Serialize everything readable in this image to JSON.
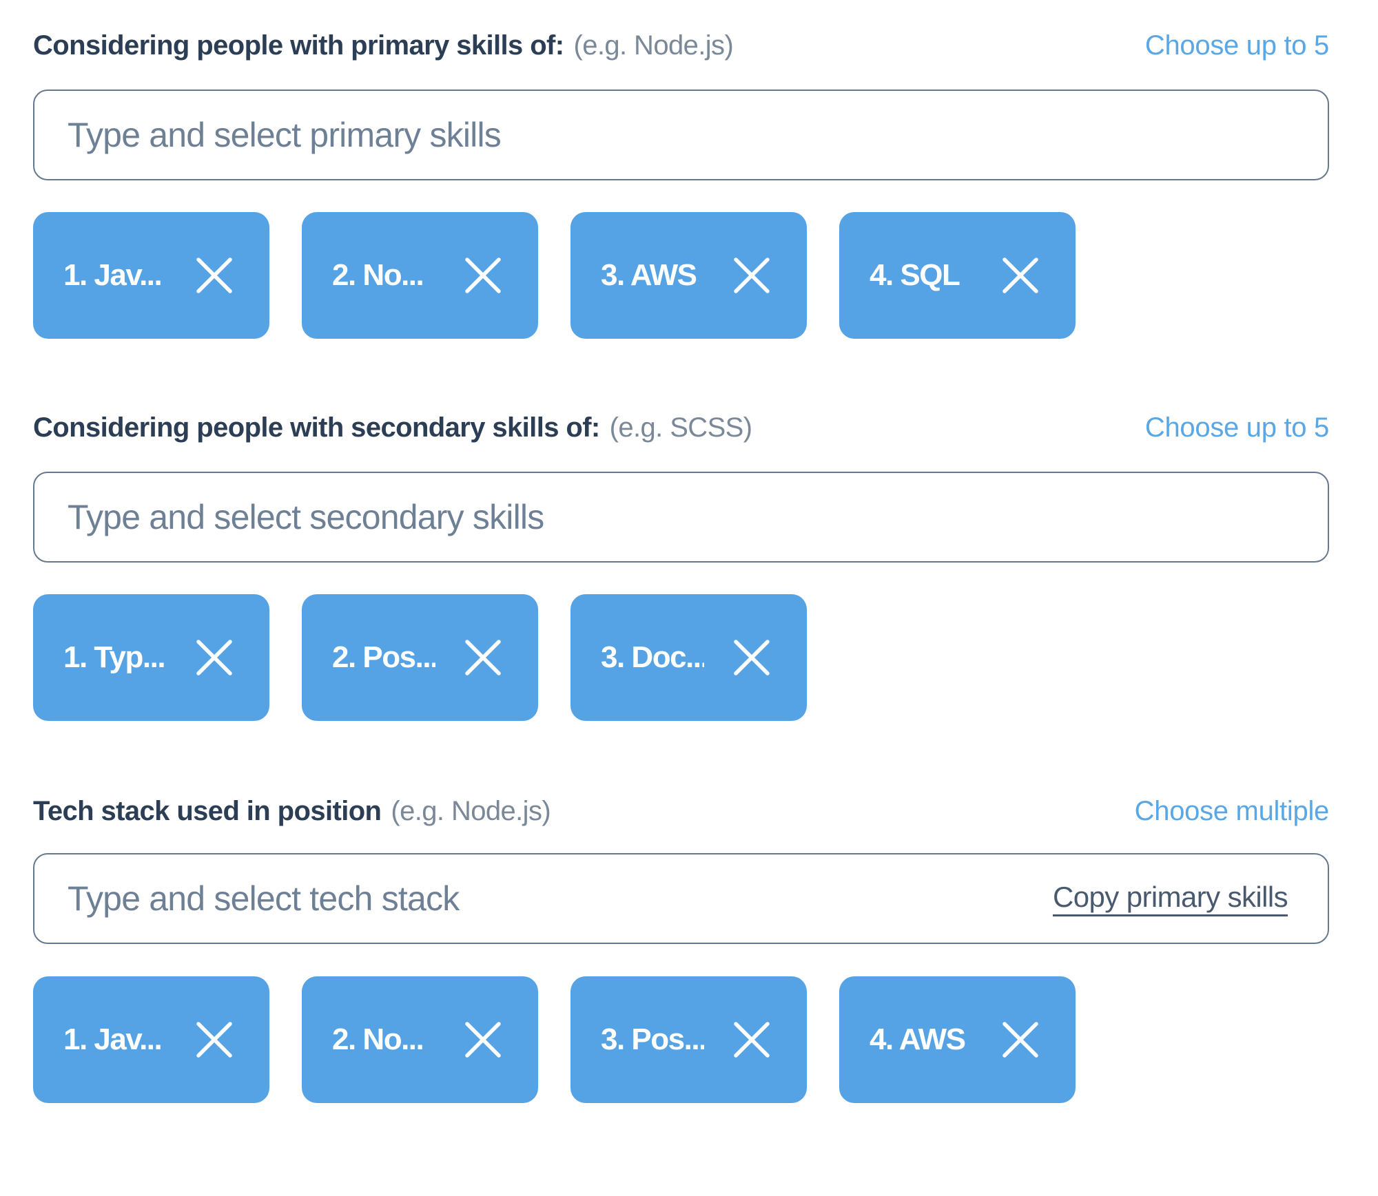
{
  "primary": {
    "title": "Considering people with primary skills of:",
    "hint": "(e.g. Node.js)",
    "limit": "Choose up to 5",
    "placeholder": "Type and select primary skills",
    "value": "",
    "chips": [
      {
        "label": "1. Jav...",
        "remove_icon": "close-icon"
      },
      {
        "label": "2. No...",
        "remove_icon": "close-icon"
      },
      {
        "label": "3. AWS",
        "remove_icon": "close-icon"
      },
      {
        "label": "4. SQL",
        "remove_icon": "close-icon"
      }
    ]
  },
  "secondary": {
    "title": "Considering people with secondary skills of:",
    "hint": "(e.g. SCSS)",
    "limit": "Choose up to 5",
    "placeholder": "Type and select secondary skills",
    "value": "",
    "chips": [
      {
        "label": "1. Typ...",
        "remove_icon": "close-icon"
      },
      {
        "label": "2. Pos...",
        "remove_icon": "close-icon"
      },
      {
        "label": "3. Doc...",
        "remove_icon": "close-icon"
      }
    ]
  },
  "tech_stack": {
    "title": "Tech stack used in position",
    "hint": "(e.g. Node.js)",
    "limit": "Choose multiple",
    "placeholder": "Type and select tech stack",
    "value": "",
    "copy_link": "Copy primary skills",
    "chips": [
      {
        "label": "1. Jav...",
        "remove_icon": "close-icon"
      },
      {
        "label": "2. No...",
        "remove_icon": "close-icon"
      },
      {
        "label": "3. Pos...",
        "remove_icon": "close-icon"
      },
      {
        "label": "4. AWS",
        "remove_icon": "close-icon"
      }
    ]
  },
  "colors": {
    "chip_background": "#55a3e4",
    "accent_link": "#5aa7e6",
    "label_text": "#2c3e55",
    "hint_text": "#7a8898",
    "input_border": "#66788e"
  }
}
